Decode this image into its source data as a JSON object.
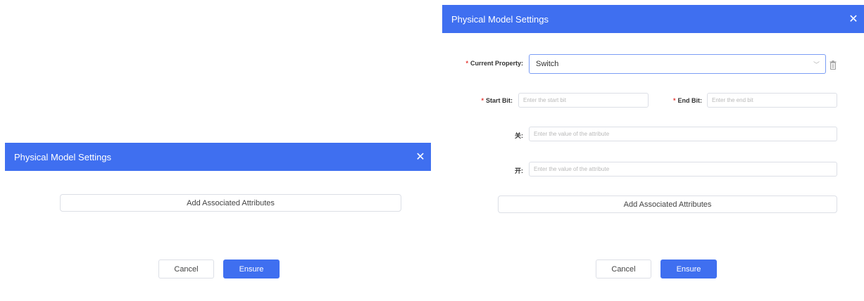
{
  "colors": {
    "primary": "#3f6ff0",
    "required": "#e53935",
    "border": "#dcdfe6"
  },
  "dialog_left": {
    "title": "Physical Model Settings",
    "close_icon": "close-icon",
    "add_attributes_label": "Add Associated Attributes",
    "cancel_label": "Cancel",
    "ensure_label": "Ensure"
  },
  "dialog_right": {
    "title": "Physical Model Settings",
    "close_icon": "close-icon",
    "current_property": {
      "required_mark": "*",
      "label": "Current Property:",
      "value": "Switch"
    },
    "start_bit": {
      "required_mark": "*",
      "label": "Start Bit:",
      "placeholder": "Enter the start bit"
    },
    "end_bit": {
      "required_mark": "*",
      "label": "End Bit:",
      "placeholder": "Enter the end bit"
    },
    "attr_off": {
      "label": "关:",
      "placeholder": "Enter the value of the attribute"
    },
    "attr_on": {
      "label": "开:",
      "placeholder": "Enter the value of the attribute"
    },
    "add_attributes_label": "Add Associated Attributes",
    "cancel_label": "Cancel",
    "ensure_label": "Ensure"
  }
}
